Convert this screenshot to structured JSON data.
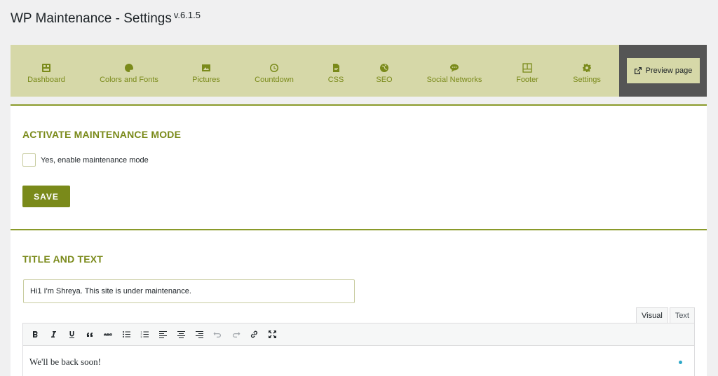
{
  "page": {
    "title": "WP Maintenance - Settings",
    "version": "v.6.1.5"
  },
  "nav": {
    "items": [
      {
        "label": "Dashboard",
        "icon": "dashboard-icon"
      },
      {
        "label": "Colors and Fonts",
        "icon": "palette-icon"
      },
      {
        "label": "Pictures",
        "icon": "pictures-icon"
      },
      {
        "label": "Countdown",
        "icon": "clock-icon"
      },
      {
        "label": "CSS",
        "icon": "css-file-icon"
      },
      {
        "label": "SEO",
        "icon": "globe-icon"
      },
      {
        "label": "Social Networks",
        "icon": "chat-bubble-icon"
      },
      {
        "label": "Footer",
        "icon": "footer-layout-icon"
      },
      {
        "label": "Settings",
        "icon": "gear-icon"
      }
    ],
    "preview_label": "Preview page",
    "accent_color": "#7a8a1a",
    "bar_color": "#d6d8a8"
  },
  "maintenance": {
    "section_title": "ACTIVATE MAINTENANCE MODE",
    "checkbox_label": "Yes, enable maintenance mode",
    "checked": false,
    "save_label": "SAVE"
  },
  "title_text": {
    "section_title": "TITLE AND TEXT",
    "title_value": "Hi1 I'm Shreya. This site is under maintenance.",
    "tabs": [
      "Visual",
      "Text"
    ],
    "active_tab": "Visual",
    "editor_content": "We'll be back soon!"
  }
}
